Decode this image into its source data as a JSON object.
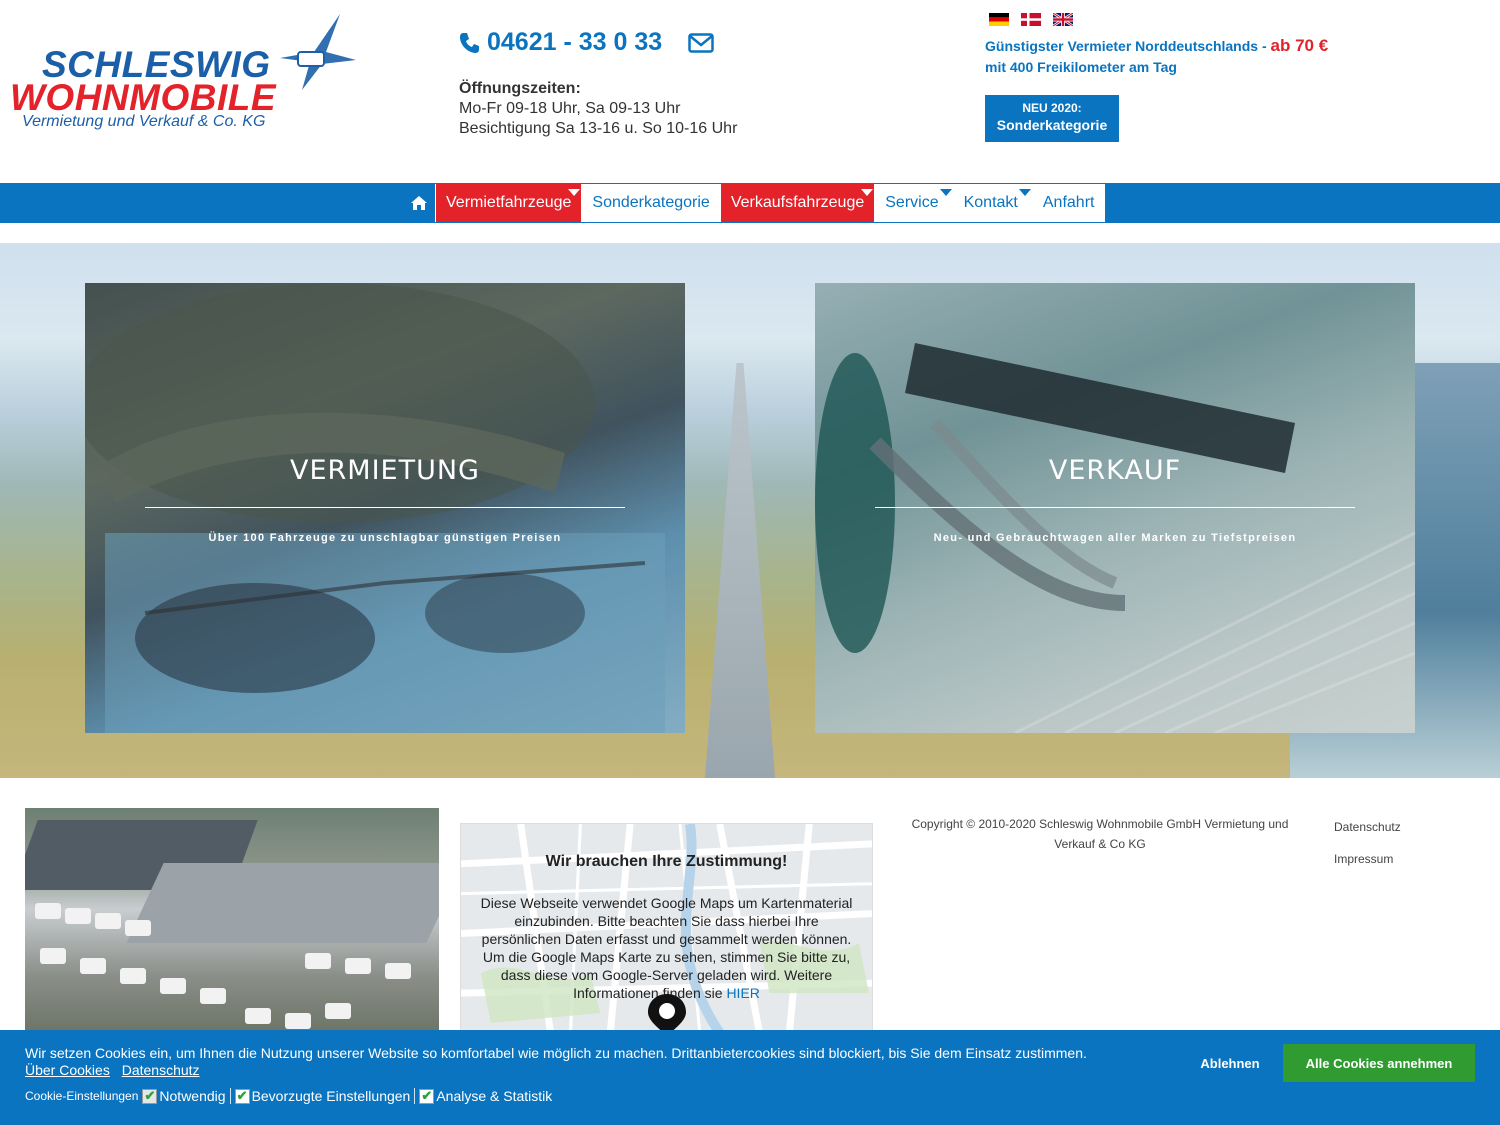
{
  "header": {
    "logo": {
      "line1": "SCHLESWIG",
      "line2": "WOHNMOBILE",
      "line3": "Vermietung und Verkauf & Co. KG"
    },
    "phone": "04621 - 33 0 33",
    "hours_title": "Öffnungszeiten:",
    "hours_line1": "Mo-Fr 09-18 Uhr, Sa 09-13 Uhr",
    "hours_line2": "Besichtigung Sa 13-16 u. So 10-16 Uhr",
    "languages": [
      "de",
      "da",
      "en"
    ],
    "promo_line1": "Günstigster Vermieter Norddeutschlands -",
    "promo_price": "ab 70 €",
    "promo_line2": "mit 400 Freikilometer am Tag",
    "new_button_top": "NEU 2020:",
    "new_button_bottom": "Sonderkategorie"
  },
  "nav": {
    "home_icon": "home-icon",
    "items": [
      {
        "label": "Vermietfahrzeuge",
        "style": "red",
        "has_dropdown": true
      },
      {
        "label": "Sonderkategorie",
        "style": "white",
        "has_dropdown": false
      },
      {
        "label": "Verkaufsfahrzeuge",
        "style": "red",
        "has_dropdown": true
      },
      {
        "label": "Service",
        "style": "white",
        "has_dropdown": true
      },
      {
        "label": "Kontakt",
        "style": "white",
        "has_dropdown": true
      },
      {
        "label": "Anfahrt",
        "style": "white",
        "has_dropdown": false
      }
    ]
  },
  "hero": {
    "cards": [
      {
        "title": "VERMIETUNG",
        "subtitle": "Über 100 Fahrzeuge zu unschlagbar günstigen Preisen"
      },
      {
        "title": "VERKAUF",
        "subtitle": "Neu- und Gebrauchtwagen aller Marken zu Tiefstpreisen"
      }
    ]
  },
  "map": {
    "title": "Wir brauchen Ihre Zustimmung!",
    "text": "Diese Webseite verwendet Google Maps um Kartenmaterial einzubinden. Bitte beachten Sie dass hierbei Ihre persönlichen Daten erfasst und gesammelt werden können. Um die Google Maps Karte zu sehen, stimmen Sie bitte zu, dass diese vom Google-Server geladen wird. Weitere Informationen finden sie",
    "link": "HIER"
  },
  "footer": {
    "copyright": "Copyright © 2010-2020 Schleswig Wohnmobile GmbH Vermietung und Verkauf & Co KG",
    "links": [
      "Datenschutz",
      "Impressum"
    ]
  },
  "cookie": {
    "message": "Wir setzen Cookies ein, um Ihnen die Nutzung unserer Website so komfortabel wie möglich zu machen. Drittanbietercookies sind blockiert, bis Sie dem Einsatz zustimmen.",
    "link_about": "Über Cookies",
    "link_privacy": "Datenschutz",
    "settings_label": "Cookie-Einstellungen",
    "options": [
      {
        "label": "Notwendig",
        "checked": true
      },
      {
        "label": "Bevorzugte Einstellungen",
        "checked": true
      },
      {
        "label": "Analyse & Statistik",
        "checked": true
      }
    ],
    "decline": "Ablehnen",
    "accept": "Alle Cookies annehmen"
  },
  "colors": {
    "brand_blue": "#0a74c0",
    "brand_red": "#e3222a",
    "accept_green": "#2f9b31"
  }
}
